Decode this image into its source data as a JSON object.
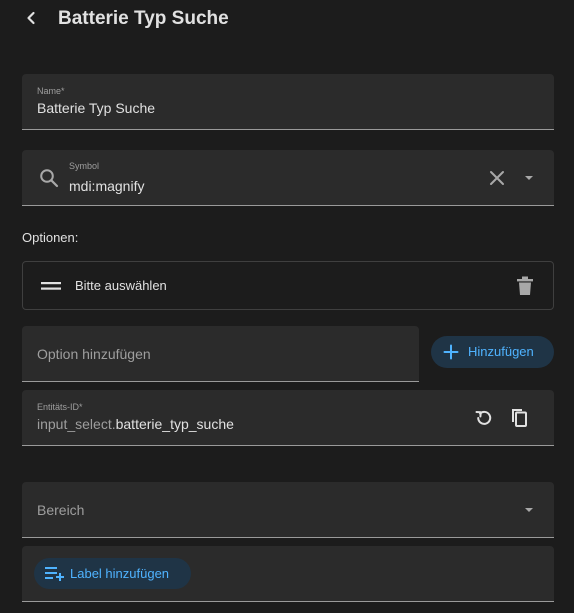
{
  "header": {
    "title": "Batterie Typ Suche",
    "back_icon": "chevron-left-icon"
  },
  "name_field": {
    "label": "Name*",
    "value": "Batterie Typ Suche"
  },
  "symbol_field": {
    "label": "Symbol",
    "value": "mdi:magnify",
    "leading_icon": "magnify-icon",
    "clear_icon": "close-icon",
    "dropdown_icon": "menu-down-icon"
  },
  "options": {
    "heading": "Optionen:",
    "items": [
      {
        "label": "Bitte auswählen",
        "drag_icon": "drag-handle-icon",
        "delete_icon": "trash-icon"
      }
    ]
  },
  "add_option": {
    "placeholder": "Option hinzufügen",
    "button_label": "Hinzufügen",
    "button_icon": "plus-icon"
  },
  "entity_id_field": {
    "label": "Entitäts-ID*",
    "prefix": "input_select.",
    "value": "batterie_typ_suche",
    "reset_icon": "restore-icon",
    "copy_icon": "copy-icon"
  },
  "area_field": {
    "placeholder": "Bereich",
    "dropdown_icon": "menu-down-icon"
  },
  "labels": {
    "button_label": "Label hinzufügen",
    "button_icon": "playlist-plus-icon"
  },
  "colors": {
    "background": "#1c1c1c",
    "field_background": "#2b2b2b",
    "accent": "#4fb3ff",
    "accent_button_background": "#1f3446",
    "text": "#e1e1e1",
    "secondary_text": "#9e9e9e"
  }
}
